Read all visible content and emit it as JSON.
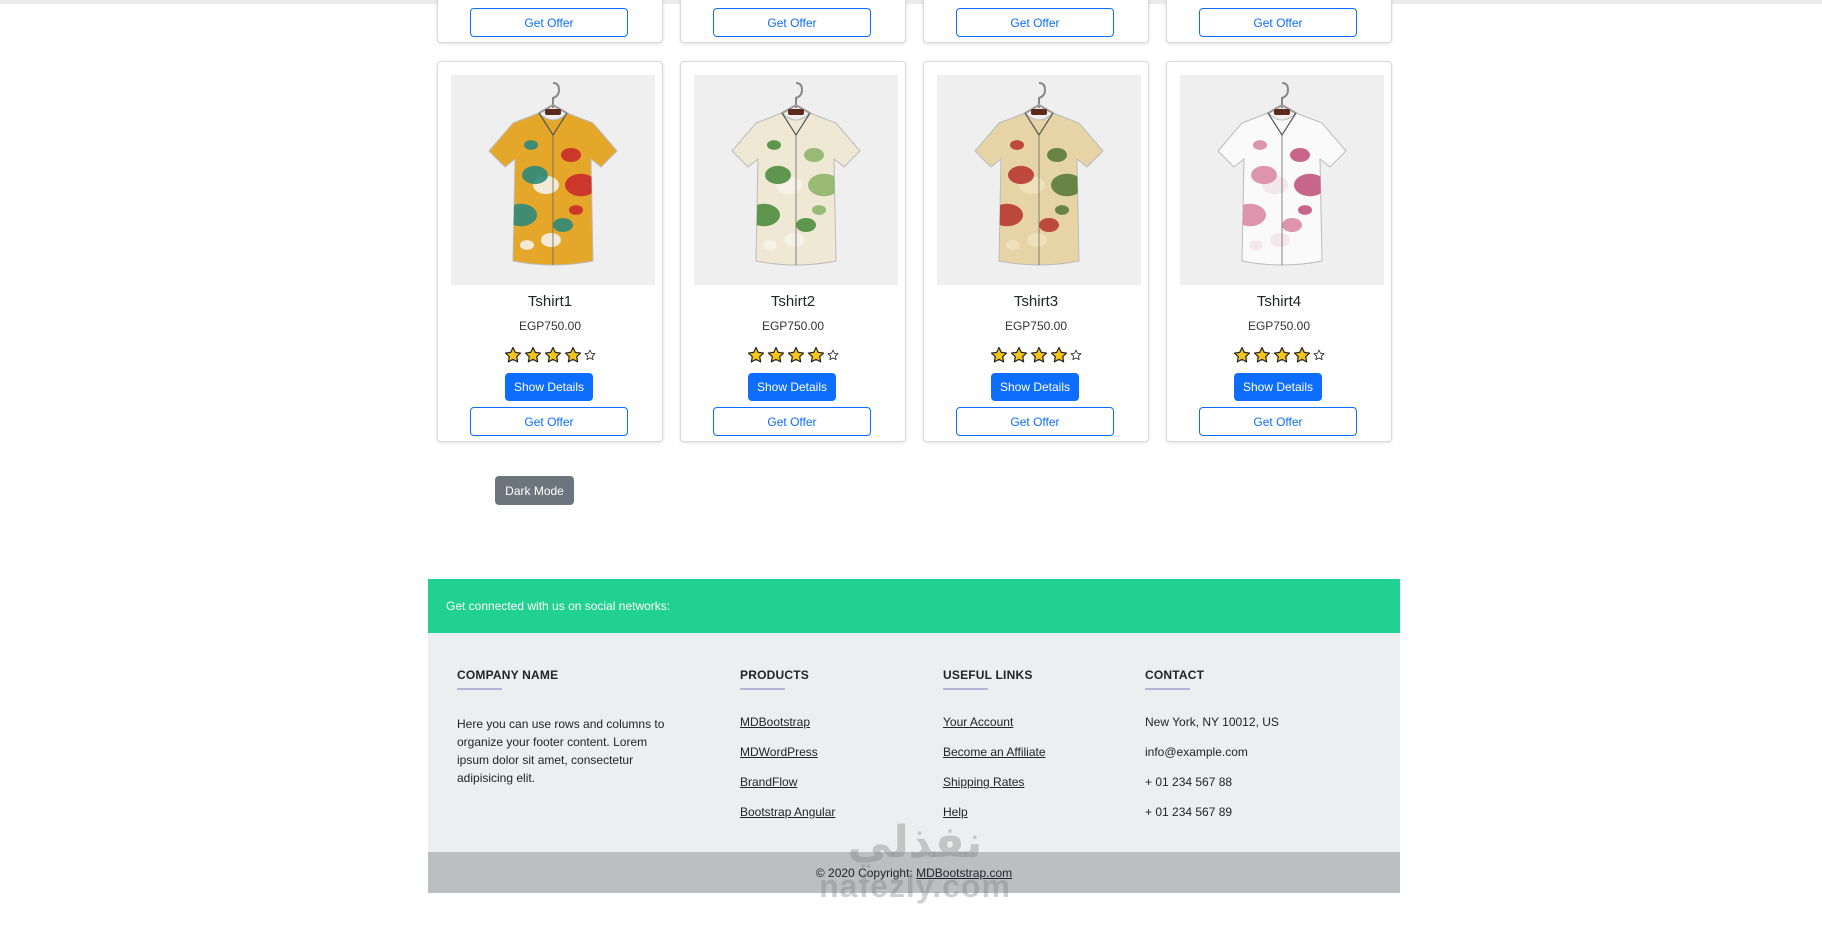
{
  "top_row": [
    {
      "offer_label": "Get Offer"
    },
    {
      "offer_label": "Get Offer"
    },
    {
      "offer_label": "Get Offer"
    },
    {
      "offer_label": "Get Offer"
    }
  ],
  "products": [
    {
      "name": "Tshirt1",
      "price": "EGP750.00",
      "rating": 4,
      "max_rating": 5,
      "details_label": "Show Details",
      "offer_label": "Get Offer",
      "image": "shirt-abstract-print-image",
      "colors": [
        "#e4a72a",
        "#2d8a7a",
        "#c92b2b",
        "#f4f1e8"
      ]
    },
    {
      "name": "Tshirt2",
      "price": "EGP750.00",
      "rating": 4,
      "max_rating": 5,
      "details_label": "Show Details",
      "offer_label": "Get Offer",
      "image": "shirt-leaf-print-image",
      "colors": [
        "#efe8d4",
        "#4f8d3e",
        "#8fb56a",
        "#f7f3ea"
      ]
    },
    {
      "name": "Tshirt3",
      "price": "EGP750.00",
      "rating": 4,
      "max_rating": 5,
      "details_label": "Show Details",
      "offer_label": "Get Offer",
      "image": "shirt-floral-print-image",
      "colors": [
        "#e6d4a6",
        "#b83a32",
        "#5b7a3a",
        "#f0e2bd"
      ]
    },
    {
      "name": "Tshirt4",
      "price": "EGP750.00",
      "rating": 4,
      "max_rating": 5,
      "details_label": "Show Details",
      "offer_label": "Get Offer",
      "image": "shirt-blossom-print-image",
      "colors": [
        "#fafafa",
        "#d98aa5",
        "#c2557d",
        "#f3e6ea"
      ]
    }
  ],
  "dark_mode_label": "Dark Mode",
  "footer": {
    "social_text": "Get connected with us on social networks:",
    "company": {
      "title": "COMPANY NAME",
      "description": "Here you can use rows and columns to organize your footer content. Lorem ipsum dolor sit amet, consectetur adipisicing elit."
    },
    "products": {
      "title": "PRODUCTS",
      "links": [
        "MDBootstrap",
        "MDWordPress",
        "BrandFlow",
        "Bootstrap Angular"
      ]
    },
    "useful_links": {
      "title": "USEFUL LINKS",
      "links": [
        "Your Account",
        "Become an Affiliate",
        "Shipping Rates",
        "Help"
      ]
    },
    "contact": {
      "title": "CONTACT",
      "items": [
        "New York, NY 10012, US",
        "info@example.com",
        "+ 01 234 567 88",
        "+ 01 234 567 89"
      ]
    },
    "copyright_prefix": "© 2020 Copyright:",
    "copyright_link": "MDBootstrap.com"
  },
  "watermark": {
    "arabic": "نفذلي",
    "latin": "nafezly.com"
  },
  "colors": {
    "primary": "#0d6efd",
    "social_bar": "#21d192",
    "footer_bg": "#eceeef",
    "copyright_bg": "#bcbfc1",
    "dark_button": "#6c757d",
    "star": "#f5c518"
  }
}
